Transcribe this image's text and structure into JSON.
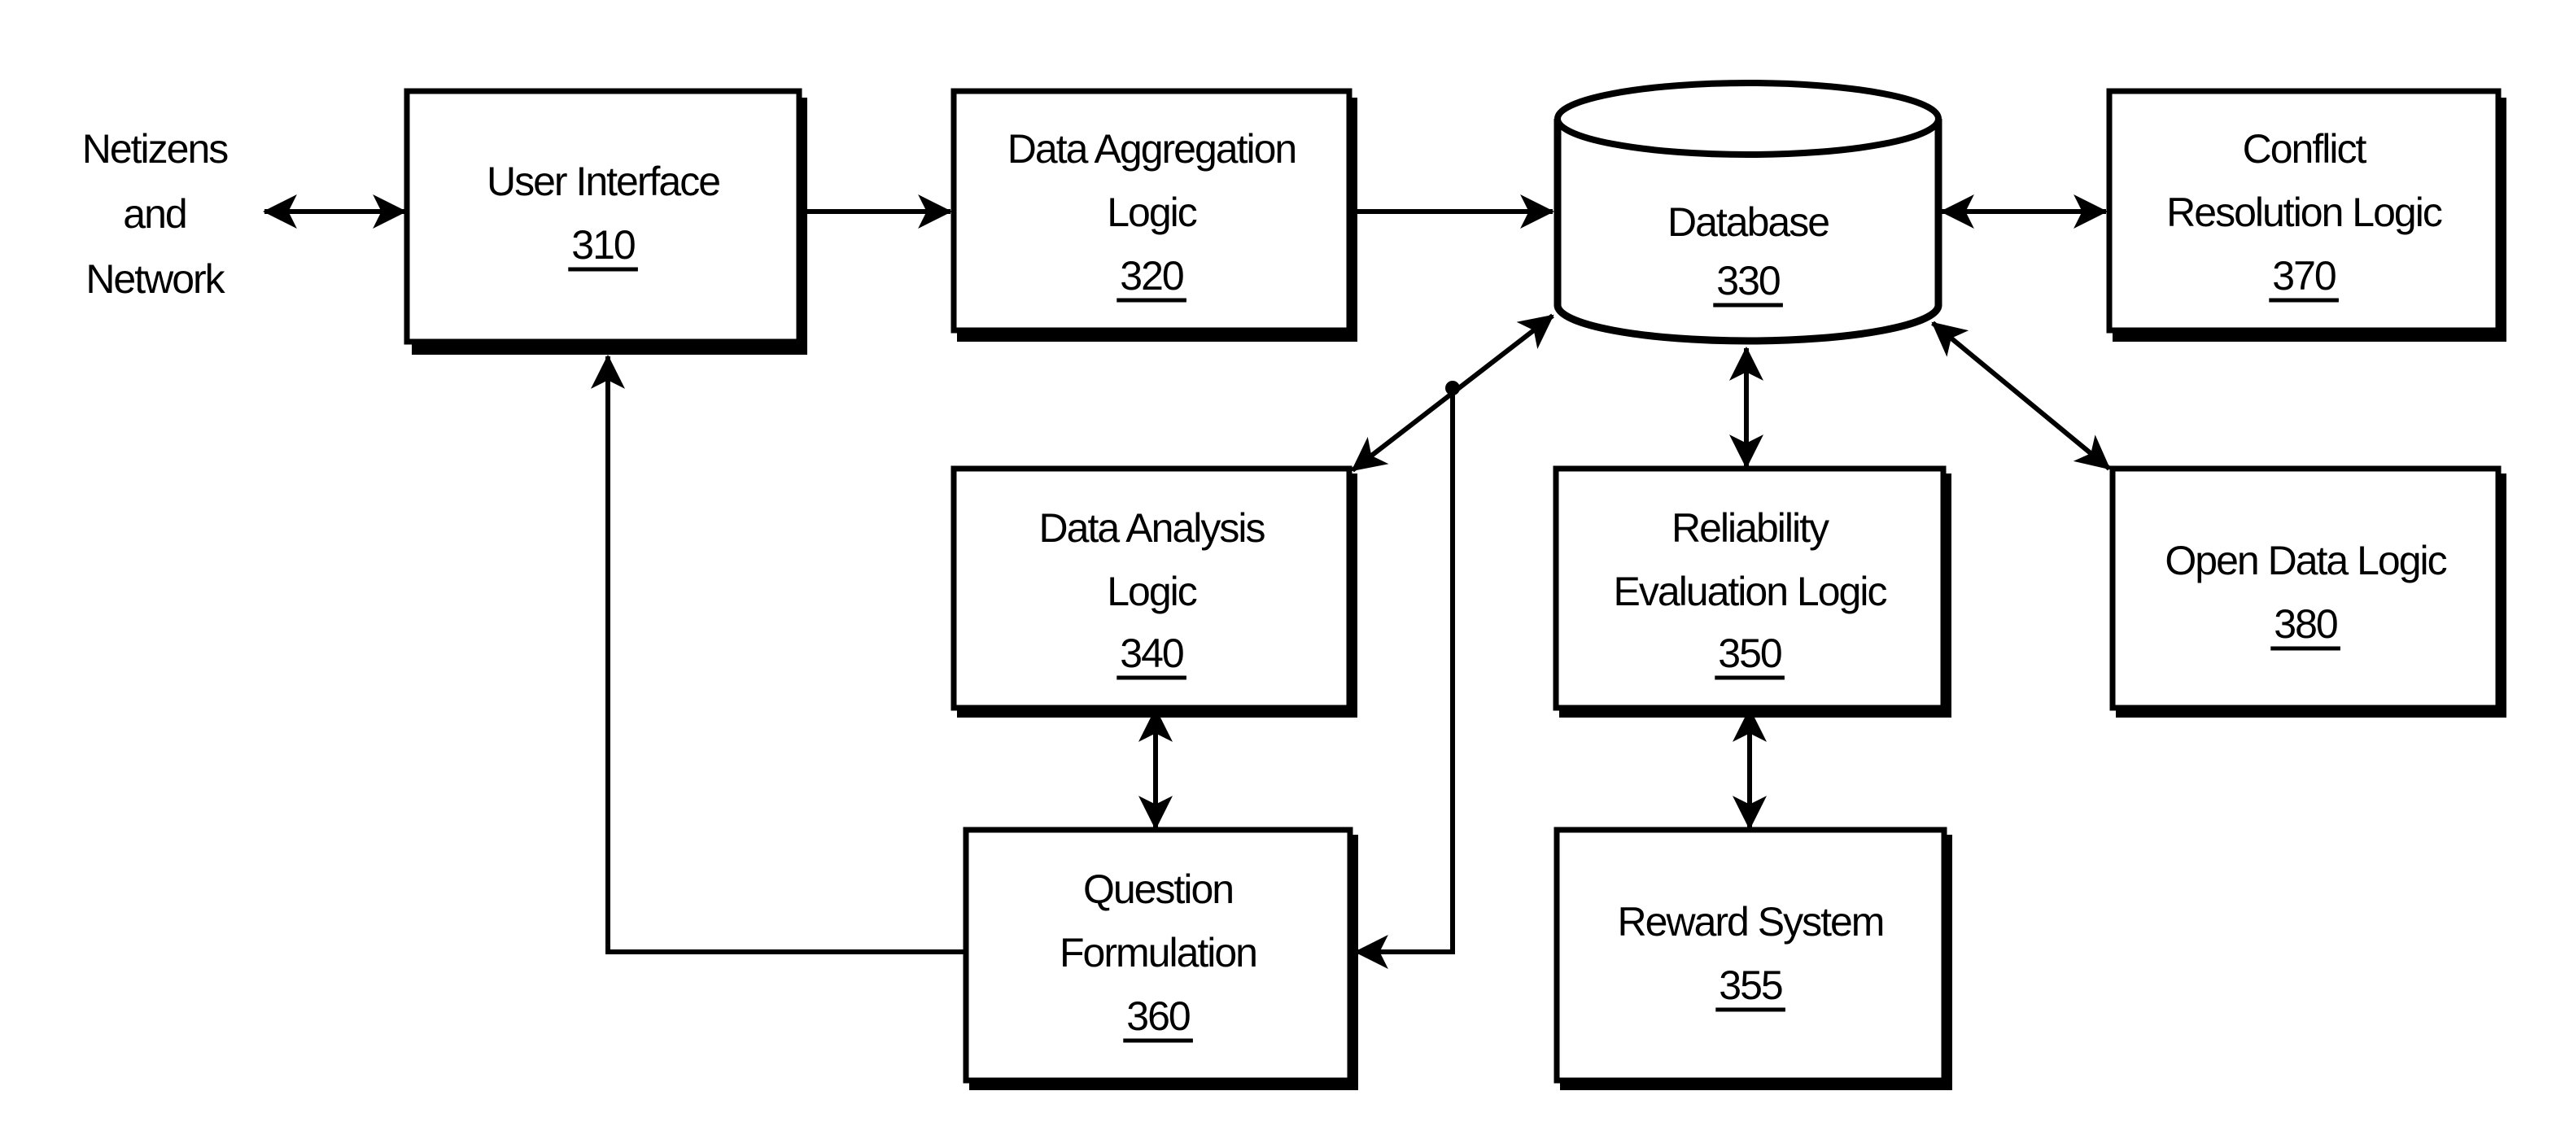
{
  "external": {
    "netizens": {
      "lines": [
        "Netizens",
        "and",
        "Network"
      ]
    }
  },
  "nodes": {
    "user_interface": {
      "lines": [
        "User Interface"
      ],
      "ref": "310"
    },
    "data_aggregation": {
      "lines": [
        "Data Aggregation",
        "Logic"
      ],
      "ref": "320"
    },
    "database": {
      "lines": [
        "Database"
      ],
      "ref": "330"
    },
    "conflict_resolution": {
      "lines": [
        "Conflict",
        "Resolution Logic"
      ],
      "ref": "370"
    },
    "data_analysis": {
      "lines": [
        "Data Analysis",
        "Logic"
      ],
      "ref": "340"
    },
    "reliability_evaluation": {
      "lines": [
        "Reliability",
        "Evaluation Logic"
      ],
      "ref": "350"
    },
    "open_data": {
      "lines": [
        "Open Data Logic"
      ],
      "ref": "380"
    },
    "question_formulation": {
      "lines": [
        "Question",
        "Formulation"
      ],
      "ref": "360"
    },
    "reward_system": {
      "lines": [
        "Reward System"
      ],
      "ref": "355"
    }
  },
  "edges": [
    {
      "from": "netizens",
      "to": "user_interface",
      "direction": "bidirectional"
    },
    {
      "from": "user_interface",
      "to": "data_aggregation",
      "direction": "forward"
    },
    {
      "from": "data_aggregation",
      "to": "database",
      "direction": "forward"
    },
    {
      "from": "database",
      "to": "conflict_resolution",
      "direction": "bidirectional"
    },
    {
      "from": "database",
      "to": "data_analysis",
      "direction": "bidirectional"
    },
    {
      "from": "database",
      "to": "reliability_evaluation",
      "direction": "bidirectional"
    },
    {
      "from": "database",
      "to": "open_data",
      "direction": "bidirectional"
    },
    {
      "from": "data_analysis",
      "to": "question_formulation",
      "direction": "bidirectional"
    },
    {
      "from": "reliability_evaluation",
      "to": "reward_system",
      "direction": "bidirectional"
    },
    {
      "from": "database",
      "to": "question_formulation",
      "direction": "forward"
    },
    {
      "from": "question_formulation",
      "to": "user_interface",
      "direction": "forward"
    }
  ]
}
